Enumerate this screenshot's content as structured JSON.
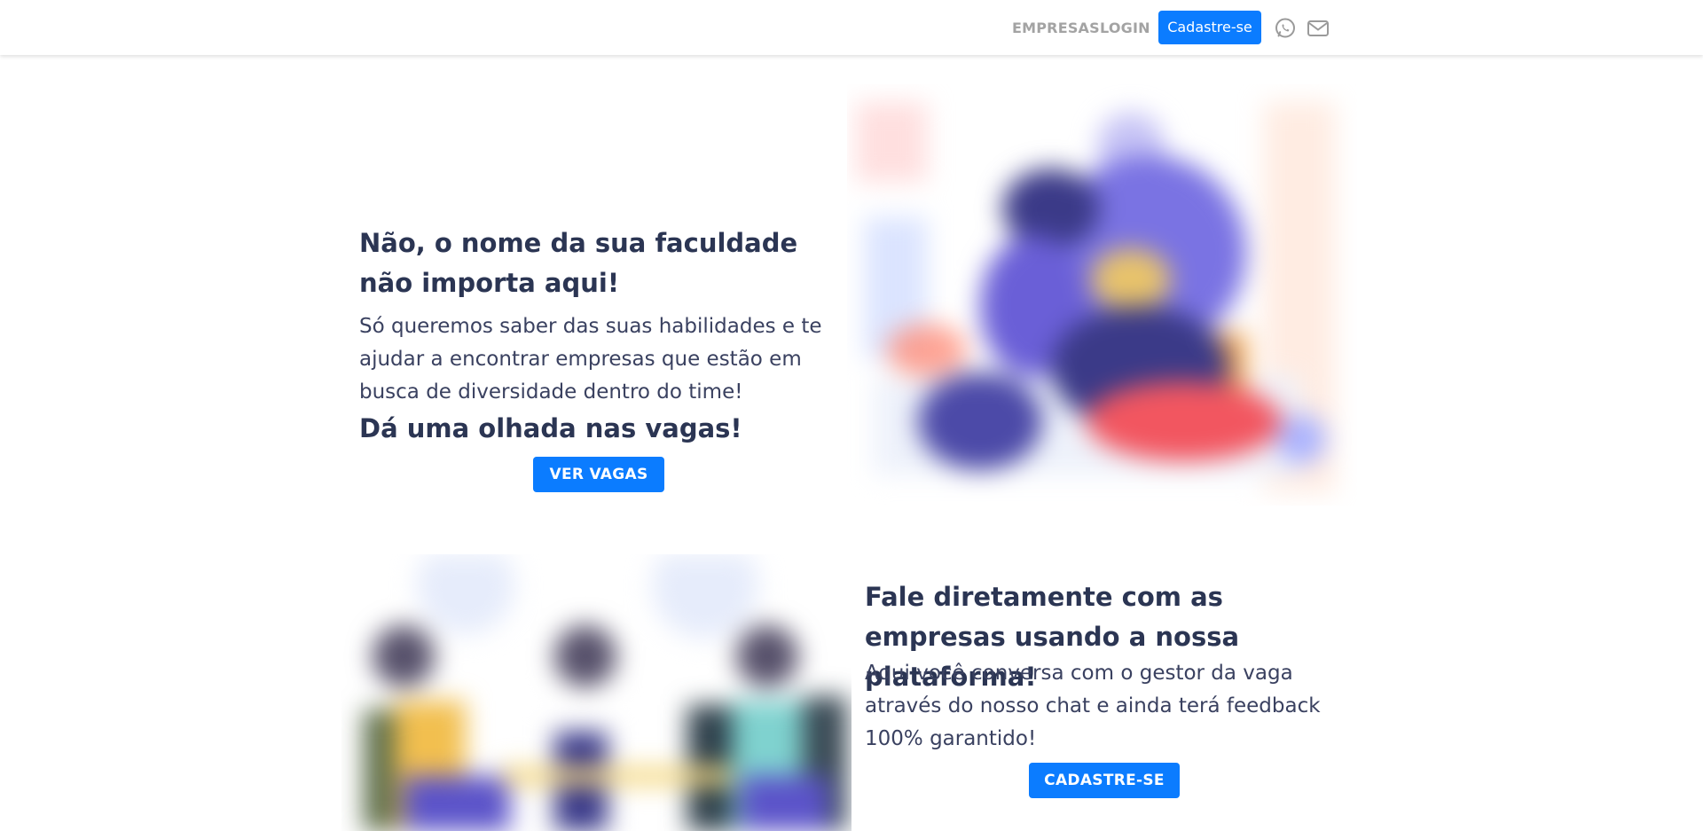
{
  "nav": {
    "links": [
      {
        "label": "EMPRESAS"
      },
      {
        "label": "LOGIN"
      }
    ],
    "cta_label": "Cadastre-se",
    "icons": [
      "whatsapp-icon",
      "mail-icon"
    ]
  },
  "section1": {
    "title": "Não, o nome da sua faculdade não importa aqui!",
    "body": "Só queremos saber das suas habilidades e te ajudar a encontrar empresas que estão em busca de diversidade dentro do time!",
    "subtitle": "Dá uma olhada nas vagas!",
    "button_label": "VER VAGAS",
    "image": "illustration-team-hero"
  },
  "section2": {
    "title": "Fale diretamente com as empresas usando a nossa plataforma!",
    "body": "Aqui você conversa com o gestor da vaga através do nosso chat e ainda terá feedback 100% garantido!",
    "button_label": "CADASTRE-SE",
    "image": "illustration-people-meeting"
  },
  "colors": {
    "accent": "#0b7cff",
    "heading": "#2b3553",
    "nav_link": "#a3a3a3"
  }
}
